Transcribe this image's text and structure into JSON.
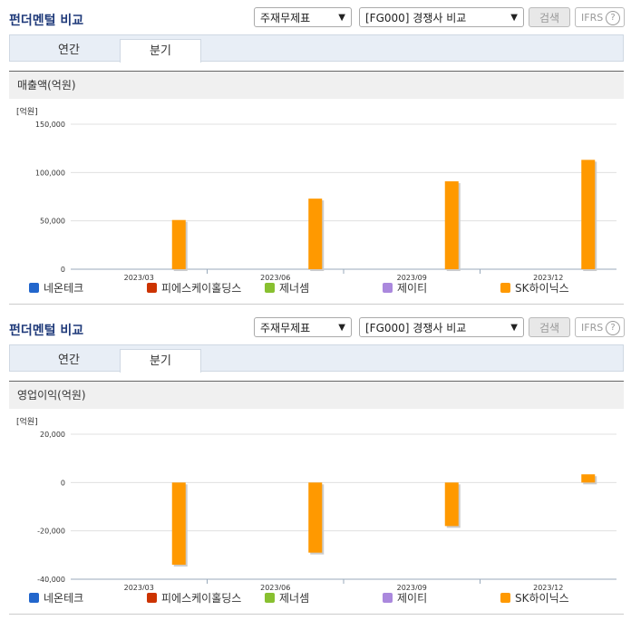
{
  "panels": [
    {
      "title": "펀더멘털 비교",
      "select1": "주재무제표",
      "select2": "[FG000] 경쟁사 비교",
      "search_label": "검색",
      "ifrs_label": "IFRS",
      "help_label": "?",
      "tabs": [
        "연간",
        "분기"
      ],
      "active_tab": "분기",
      "chart_title": "매출액(억원)"
    },
    {
      "title": "펀더멘털 비교",
      "select1": "주재무제표",
      "select2": "[FG000] 경쟁사 비교",
      "search_label": "검색",
      "ifrs_label": "IFRS",
      "help_label": "?",
      "tabs": [
        "연간",
        "분기"
      ],
      "active_tab": "분기",
      "chart_title": "영업이익(억원)"
    }
  ],
  "legend": [
    {
      "name": "네온테크",
      "color": "#2266cc"
    },
    {
      "name": "피에스케이홀딩스",
      "color": "#cc3300"
    },
    {
      "name": "제너셈",
      "color": "#88c030"
    },
    {
      "name": "제이티",
      "color": "#aa88dd"
    },
    {
      "name": "SK하이닉스",
      "color": "#ff9900"
    }
  ],
  "chart_data": [
    {
      "type": "bar",
      "unit_label": "[억원]",
      "categories": [
        "2023/03",
        "2023/06",
        "2023/09",
        "2023/12"
      ],
      "ylim": [
        0,
        150000
      ],
      "yticks": [
        0,
        50000,
        100000,
        150000
      ],
      "ytick_labels": [
        "0",
        "50,000",
        "100,000",
        "150,000"
      ],
      "grid": true,
      "legend_position": "bottom",
      "series": [
        {
          "name": "네온테크",
          "values": [
            null,
            null,
            null,
            null
          ]
        },
        {
          "name": "피에스케이홀딩스",
          "values": [
            null,
            null,
            null,
            null
          ]
        },
        {
          "name": "제너셈",
          "values": [
            null,
            null,
            null,
            null
          ]
        },
        {
          "name": "제이티",
          "values": [
            null,
            null,
            null,
            null
          ]
        },
        {
          "name": "SK하이닉스",
          "values": [
            50900,
            73000,
            90900,
            113100
          ]
        }
      ]
    },
    {
      "type": "bar",
      "unit_label": "[억원]",
      "categories": [
        "2023/03",
        "2023/06",
        "2023/09",
        "2023/12"
      ],
      "ylim": [
        -40000,
        20000
      ],
      "yticks": [
        -40000,
        -20000,
        0,
        20000
      ],
      "ytick_labels": [
        "-40,000",
        "-20,000",
        "0",
        "20,000"
      ],
      "grid": true,
      "legend_position": "bottom",
      "series": [
        {
          "name": "네온테크",
          "values": [
            null,
            null,
            null,
            null
          ]
        },
        {
          "name": "피에스케이홀딩스",
          "values": [
            null,
            null,
            null,
            null
          ]
        },
        {
          "name": "제너셈",
          "values": [
            null,
            null,
            null,
            null
          ]
        },
        {
          "name": "제이티",
          "values": [
            null,
            null,
            null,
            null
          ]
        },
        {
          "name": "SK하이닉스",
          "values": [
            -34000,
            -29000,
            -18000,
            3400
          ]
        }
      ]
    }
  ]
}
